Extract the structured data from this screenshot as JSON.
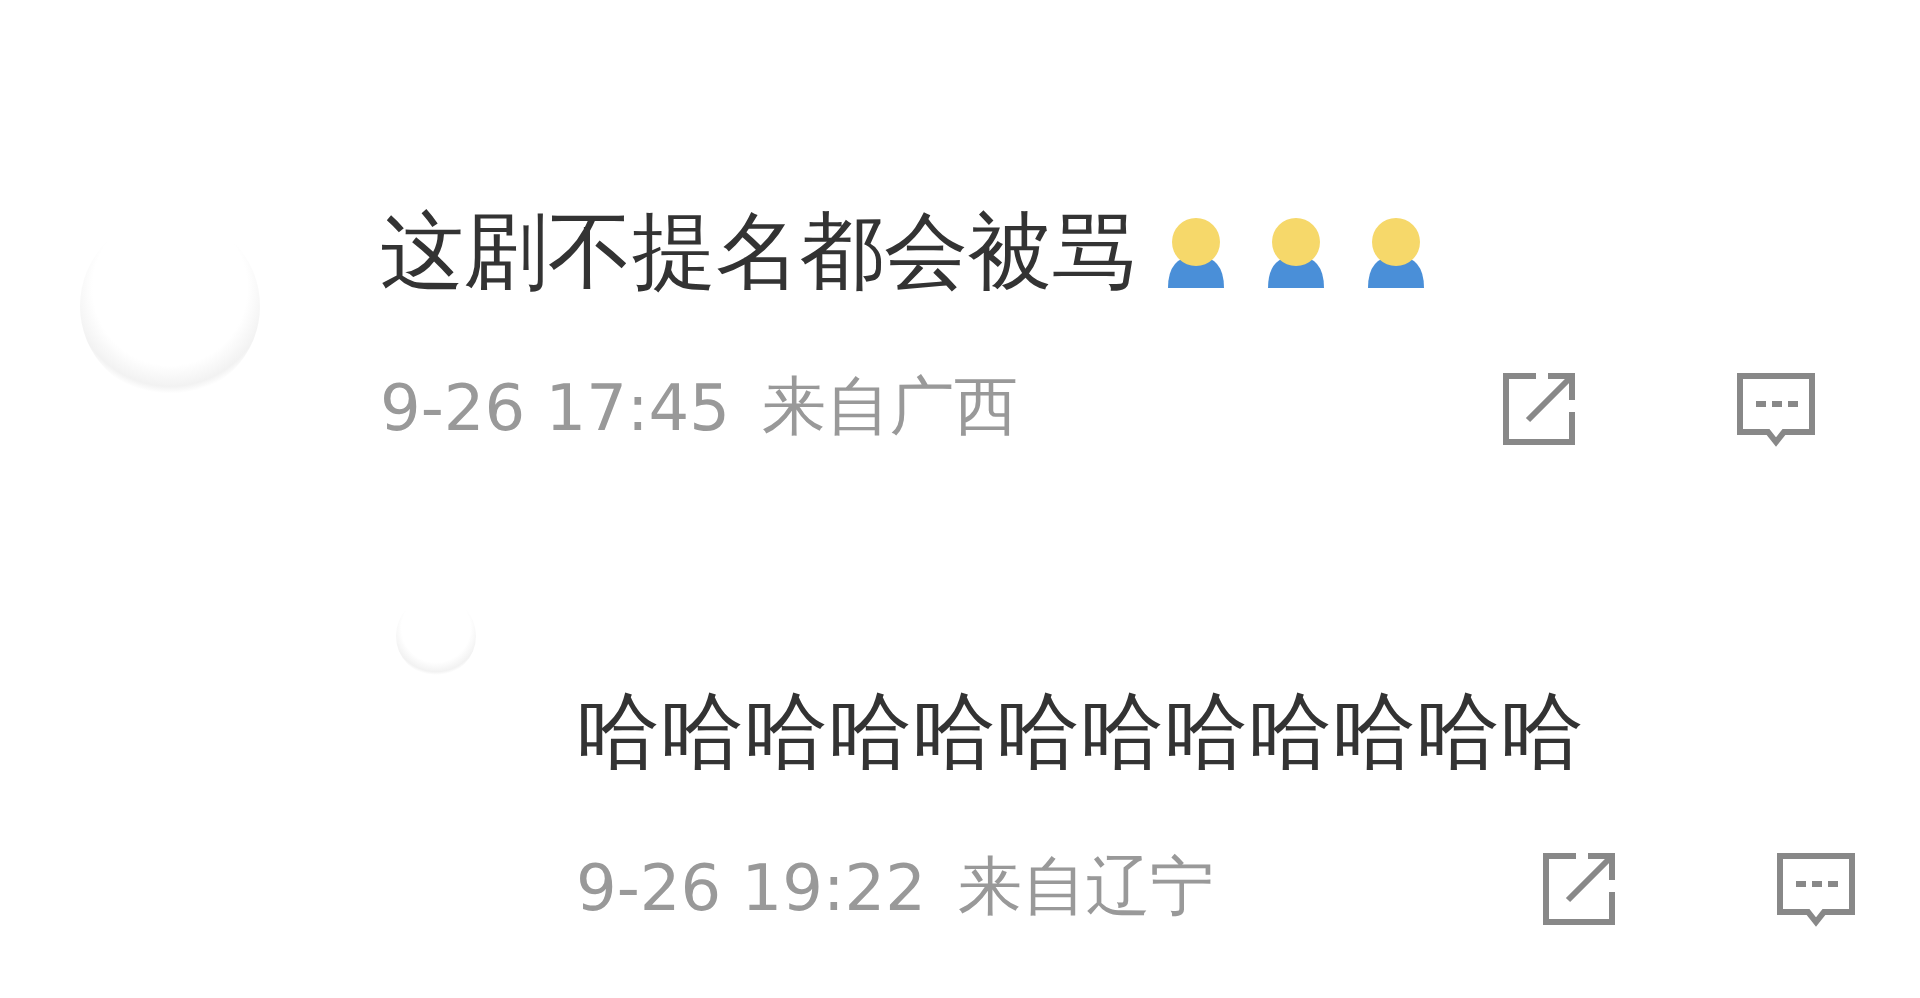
{
  "comments": [
    {
      "text": "这剧不提名都会被骂",
      "emojis": [
        {
          "kind": "figure"
        },
        {
          "kind": "figure"
        },
        {
          "kind": "figure"
        }
      ],
      "time": "9-26 17:45",
      "location": "来自广西",
      "reply": false
    },
    {
      "text": "哈哈哈哈哈哈哈哈哈哈哈哈",
      "time": "9-26 19:22",
      "location": "来自辽宁",
      "reply": true
    }
  ]
}
